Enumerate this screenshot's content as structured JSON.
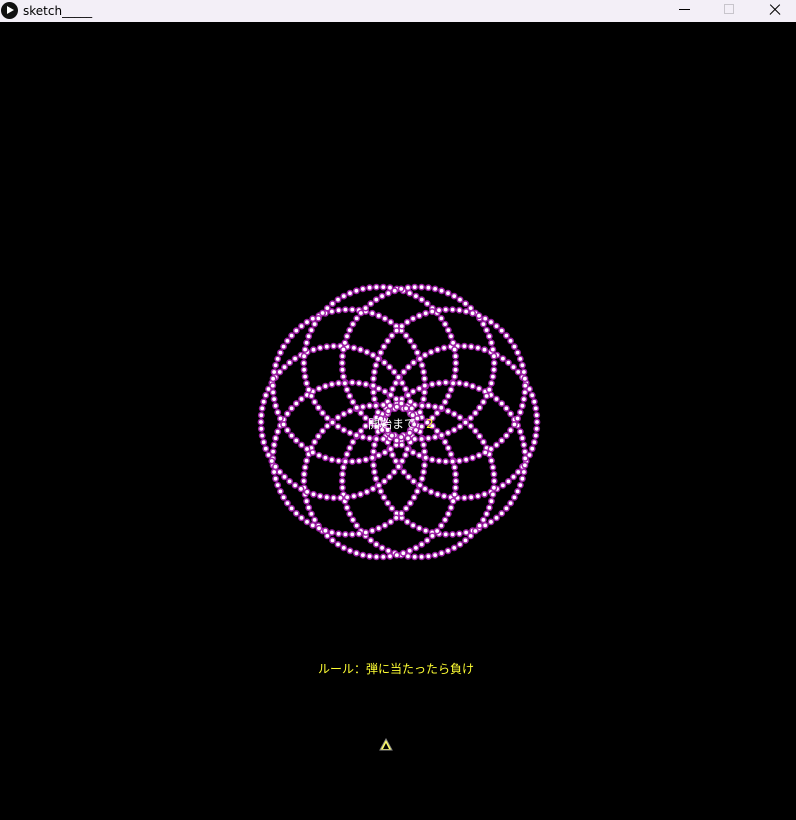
{
  "window": {
    "title": "sketch_____",
    "controls": [
      "minimize-button",
      "maximize-button",
      "close-button"
    ]
  },
  "game": {
    "countdown_label": "開始まで",
    "countdown_value": "2",
    "rule_text": "ルール：弾に当たったら負け"
  },
  "colors": {
    "background": "#000000",
    "titlebar": "#f3eff7",
    "bullet_outer": "#a020a8",
    "bullet_inner": "#ffffff",
    "text_white": "#ffffff",
    "text_yellow": "#ffff33",
    "player_fill": "#ffff66"
  }
}
